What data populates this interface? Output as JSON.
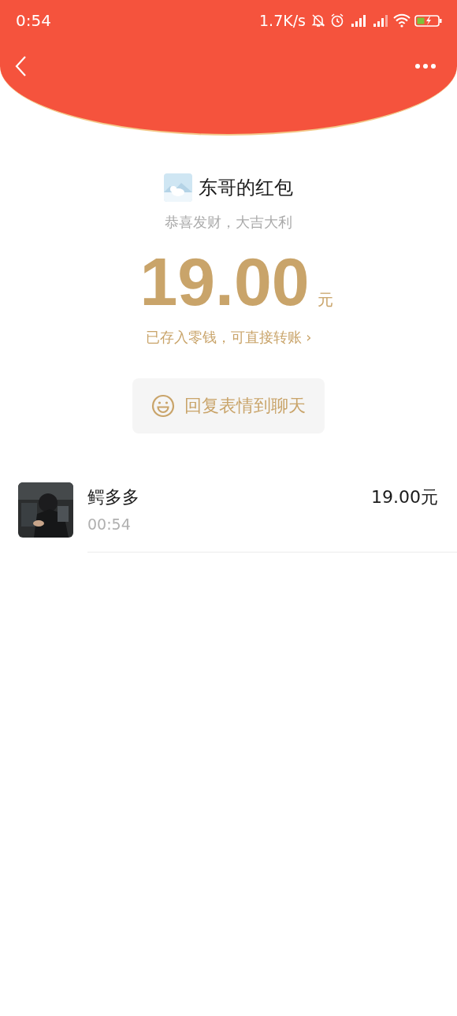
{
  "status_bar": {
    "time": "0:54",
    "speed": "1.7K/s"
  },
  "sender": {
    "title": "东哥的红包",
    "wish": "恭喜发财，大吉大利"
  },
  "amount": {
    "value": "19.00",
    "unit": "元",
    "note": "已存入零钱，可直接转账",
    "arrow": "›"
  },
  "reply_button": {
    "label": "回复表情到聊天"
  },
  "receivers": [
    {
      "name": "鳄多多",
      "time": "00:54",
      "amount": "19.00元"
    }
  ]
}
